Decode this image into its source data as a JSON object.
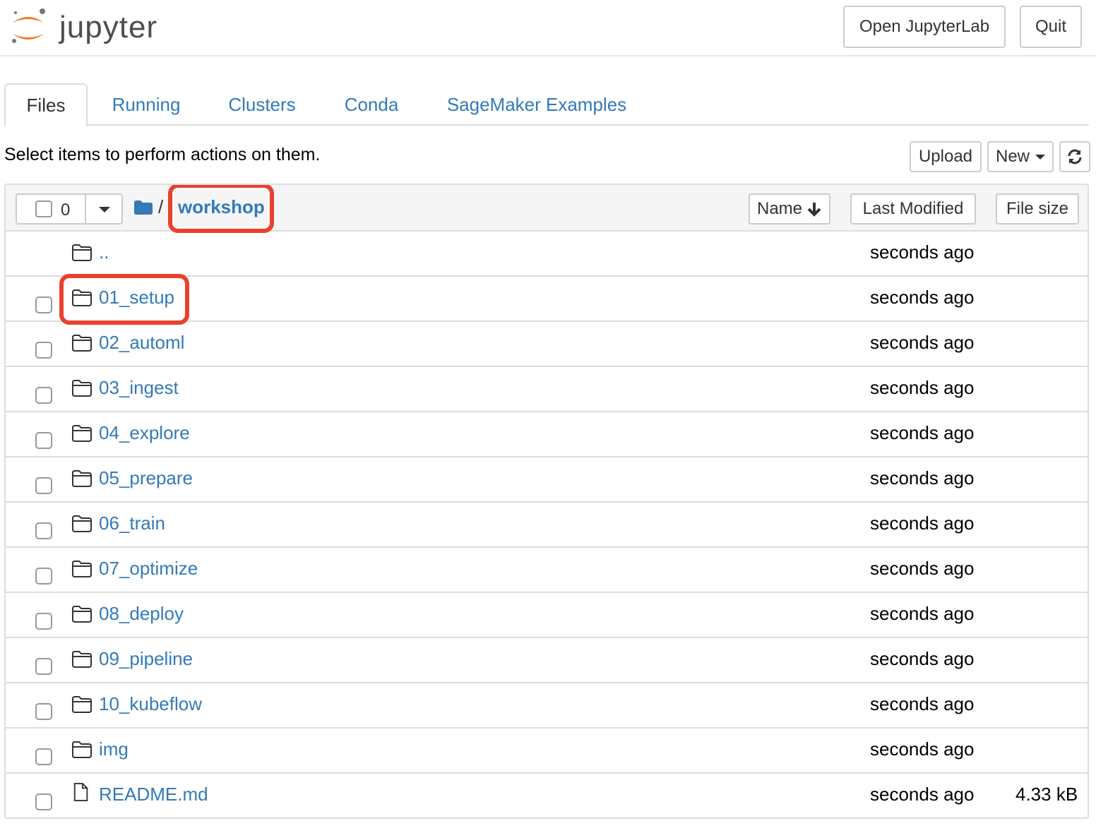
{
  "header": {
    "logo_text": "jupyter",
    "open_lab_label": "Open JupyterLab",
    "quit_label": "Quit"
  },
  "tabs": [
    {
      "label": "Files",
      "active": true
    },
    {
      "label": "Running"
    },
    {
      "label": "Clusters"
    },
    {
      "label": "Conda"
    },
    {
      "label": "SageMaker Examples"
    }
  ],
  "toolbar": {
    "hint": "Select items to perform actions on them.",
    "upload_label": "Upload",
    "new_label": "New",
    "refresh_icon": "refresh-icon"
  },
  "list_header": {
    "selected_count": "0",
    "breadcrumb_separator": "/",
    "breadcrumb_current": "workshop",
    "sort_name_label": "Name",
    "sort_modified_label": "Last Modified",
    "sort_size_label": "File size"
  },
  "rows": [
    {
      "name": "..",
      "type": "folder",
      "modified": "seconds ago",
      "size": ""
    },
    {
      "name": "01_setup",
      "type": "folder",
      "modified": "seconds ago",
      "size": ""
    },
    {
      "name": "02_automl",
      "type": "folder",
      "modified": "seconds ago",
      "size": ""
    },
    {
      "name": "03_ingest",
      "type": "folder",
      "modified": "seconds ago",
      "size": ""
    },
    {
      "name": "04_explore",
      "type": "folder",
      "modified": "seconds ago",
      "size": ""
    },
    {
      "name": "05_prepare",
      "type": "folder",
      "modified": "seconds ago",
      "size": ""
    },
    {
      "name": "06_train",
      "type": "folder",
      "modified": "seconds ago",
      "size": ""
    },
    {
      "name": "07_optimize",
      "type": "folder",
      "modified": "seconds ago",
      "size": ""
    },
    {
      "name": "08_deploy",
      "type": "folder",
      "modified": "seconds ago",
      "size": ""
    },
    {
      "name": "09_pipeline",
      "type": "folder",
      "modified": "seconds ago",
      "size": ""
    },
    {
      "name": "10_kubeflow",
      "type": "folder",
      "modified": "seconds ago",
      "size": ""
    },
    {
      "name": "img",
      "type": "folder",
      "modified": "seconds ago",
      "size": ""
    },
    {
      "name": "README.md",
      "type": "file",
      "modified": "seconds ago",
      "size": "4.33 kB"
    }
  ],
  "colors": {
    "link": "#337ab7",
    "highlight": "#e8412d",
    "logo_orange": "#f37726"
  }
}
